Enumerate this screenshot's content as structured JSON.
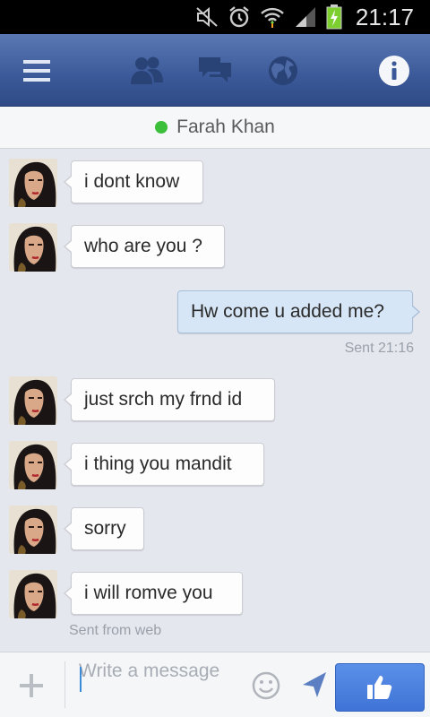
{
  "status_bar": {
    "time": "21:17"
  },
  "nav": {
    "icons": [
      "menu-icon",
      "friends-icon",
      "messages-icon",
      "globe-icon",
      "info-icon"
    ],
    "info_glyph": "i"
  },
  "contact": {
    "name": "Farah Khan",
    "online_color": "#3cbf3a"
  },
  "messages": [
    {
      "direction": "in",
      "text": "i dont know"
    },
    {
      "direction": "in",
      "text": "who are you ?"
    },
    {
      "direction": "out",
      "text": "Hw come u added me?",
      "meta": "Sent 21:16"
    },
    {
      "direction": "in",
      "text": "just srch my frnd id"
    },
    {
      "direction": "in",
      "text": "i thing you mandit"
    },
    {
      "direction": "in",
      "text": "sorry"
    },
    {
      "direction": "in",
      "text": "i will romve you",
      "meta": "Sent from web"
    }
  ],
  "composer": {
    "placeholder": "Write a message",
    "value": "",
    "plus_glyph": "+"
  },
  "colors": {
    "nav_bar": "#3b5998",
    "outgoing_bubble": "#d7e6f6",
    "incoming_bubble": "#fdfdfd",
    "like_button": "#4a7fdc"
  }
}
